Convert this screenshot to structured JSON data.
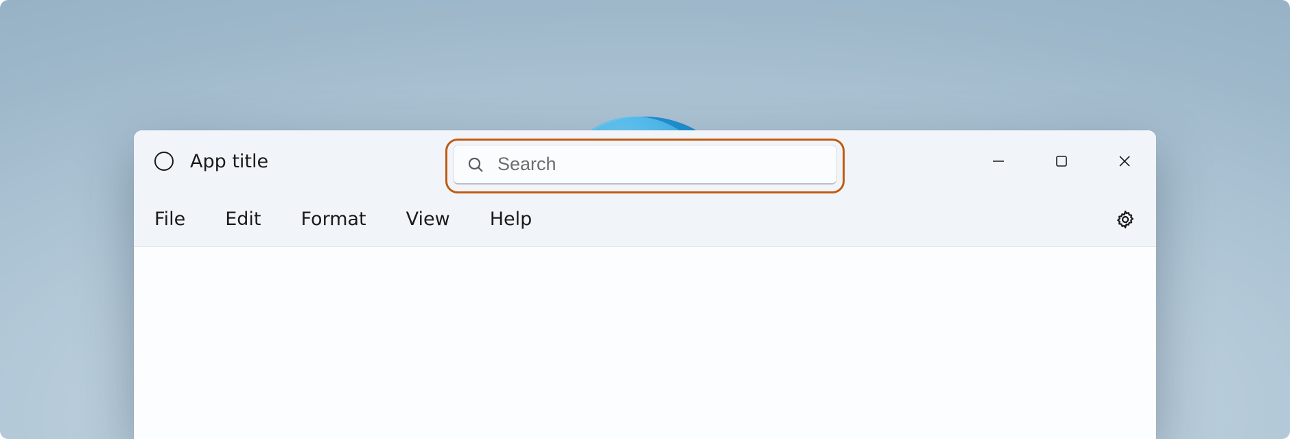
{
  "titlebar": {
    "app_title": "App title",
    "search_placeholder": "Search"
  },
  "menubar": {
    "items": [
      "File",
      "Edit",
      "Format",
      "View",
      "Help"
    ]
  },
  "highlight": {
    "target": "search-box",
    "color": "#c05a12"
  }
}
